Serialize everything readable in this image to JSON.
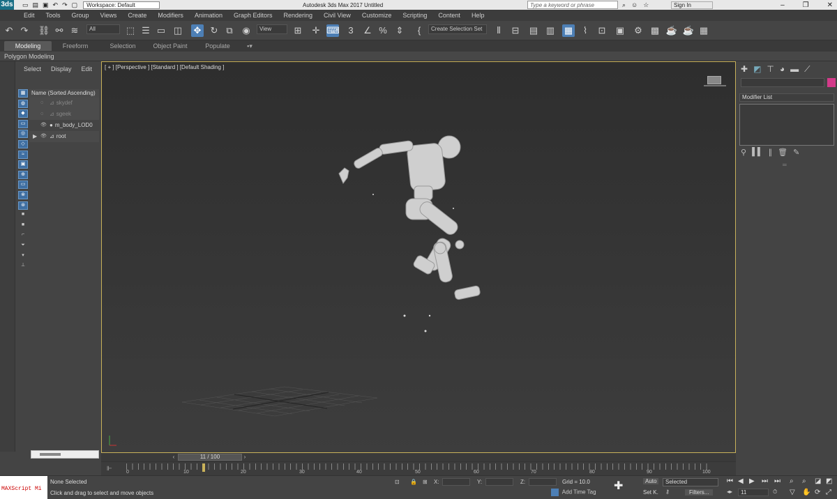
{
  "titlebar": {
    "app_icon": "3ds",
    "workspace": "Workspace: Default",
    "doc_title": "Autodesk 3ds Max 2017    Untitled",
    "search_placeholder": "Type a keyword or phrase",
    "signin": "Sign In"
  },
  "menu": [
    "Edit",
    "Tools",
    "Group",
    "Views",
    "Create",
    "Modifiers",
    "Animation",
    "Graph Editors",
    "Rendering",
    "Civil View",
    "Customize",
    "Scripting",
    "Content",
    "Help"
  ],
  "toolbar": {
    "filter": "All",
    "ref_coord": "View",
    "named_sel": "Create Selection Set"
  },
  "ribbon": {
    "tabs": [
      "Modeling",
      "Freeform",
      "Selection",
      "Object Paint",
      "Populate"
    ],
    "sub": "Polygon Modeling"
  },
  "explorer": {
    "tabs": [
      "Select",
      "Display",
      "Edit"
    ],
    "header": "Name (Sorted Ascending)",
    "rows": [
      {
        "name": "skydef"
      },
      {
        "name": "sgeek"
      },
      {
        "name": "m_body_LOD0"
      },
      {
        "name": "root"
      }
    ]
  },
  "viewport": {
    "label": "[ + ] [Perspective ] [Standard ] [Default Shading ]"
  },
  "command_panel": {
    "modifier_list": "Modifier List"
  },
  "timeline": {
    "frame_display": "11 / 100",
    "tick_labels": [
      "0",
      "10",
      "20",
      "30",
      "40",
      "50",
      "60",
      "70",
      "80",
      "90",
      "100"
    ]
  },
  "status": {
    "maxscript": "MAXScript Mi",
    "selection": "None Selected",
    "prompt": "Click and drag to select and move objects",
    "x_label": "X:",
    "y_label": "Y:",
    "z_label": "Z:",
    "grid": "Grid = 10.0",
    "add_time_tag": "Add Time Tag",
    "auto": "Auto",
    "selected": "Selected",
    "setk": "Set K.",
    "filters": "Filters...",
    "frame": "11"
  },
  "colors": {
    "accent": "#4d7fb5",
    "viewport_border": "#c9b25a",
    "swatch": "#d33a8a"
  }
}
